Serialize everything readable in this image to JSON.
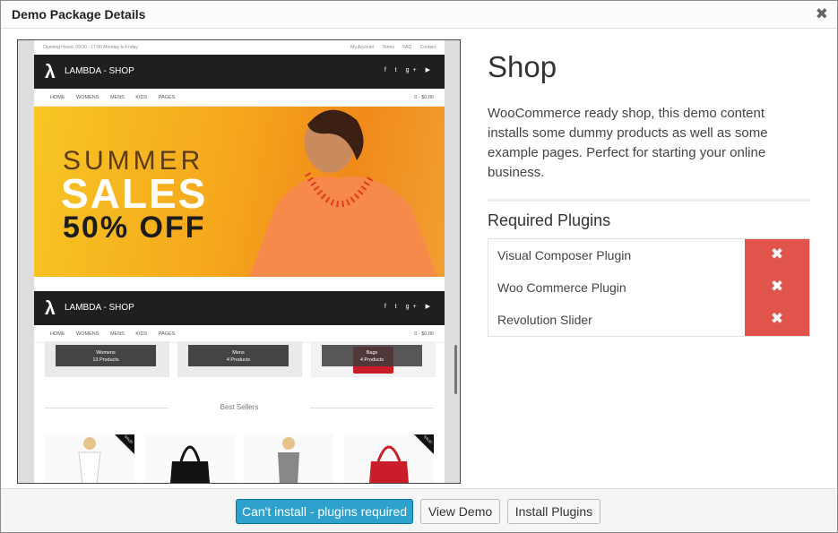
{
  "modal": {
    "title": "Demo Package Details",
    "close": "✖"
  },
  "preview": {
    "opening_hours": "Opening Hours: 09:00 - 17:00 Monday to Friday",
    "top_links": [
      "My Account",
      "Terms",
      "FAQ",
      "Contact"
    ],
    "shop_name": "LAMBDA - SHOP",
    "social": "f  t  g+  ▶",
    "nav_items": [
      "HOME",
      "WOMENS",
      "MENS",
      "KIDS",
      "PAGES"
    ],
    "cart": "0 - $0.00",
    "banner": {
      "line1": "SUMMER",
      "line2": "SALES",
      "line3": "50% OFF"
    },
    "categories": [
      {
        "name": "Womens",
        "count": "13 Products"
      },
      {
        "name": "Mens",
        "count": "4 Products"
      },
      {
        "name": "Bags",
        "count": "4 Products"
      }
    ],
    "best_sellers": "Best Sellers",
    "sale_badge": "SALE!"
  },
  "details": {
    "title": "Shop",
    "description": "WooCommerce ready shop, this demo content installs some dummy products as well as some example pages. Perfect for starting your online business.",
    "required_title": "Required Plugins",
    "plugins": [
      "Visual Composer Plugin",
      "Woo Commerce Plugin",
      "Revolution Slider"
    ],
    "status_icon": "✖"
  },
  "footer": {
    "cant_install": "Can't install - plugins required",
    "view_demo": "View Demo",
    "install_plugins": "Install Plugins"
  },
  "colors": {
    "primary": "#2ea2cc",
    "missing": "#e0544c"
  }
}
